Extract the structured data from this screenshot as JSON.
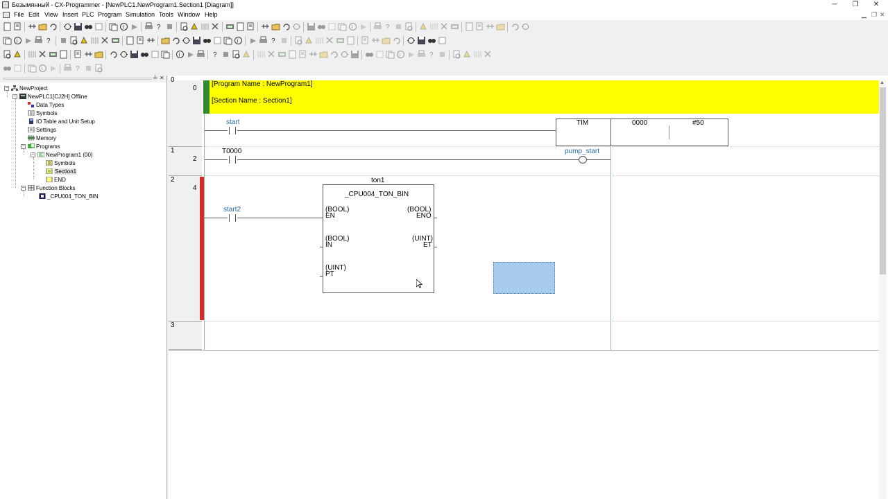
{
  "window": {
    "title": "Безымянный - CX-Programmer - [NewPLC1.NewProgram1.Section1 [Diagram]]",
    "minimize": "─",
    "restore": "❐",
    "close": "✕"
  },
  "menu": [
    "File",
    "Edit",
    "View",
    "Insert",
    "PLC",
    "Program",
    "Simulation",
    "Tools",
    "Window",
    "Help"
  ],
  "tree": {
    "project": "NewProject",
    "plc": "NewPLC1[CJ2H] Offline",
    "data_types": "Data Types",
    "symbols": "Symbols",
    "io_table": "IO Table and Unit Setup",
    "settings": "Settings",
    "memory": "Memory",
    "programs": "Programs",
    "program": "NewProgram1 (00)",
    "prog_symbols": "Symbols",
    "section": "Section1",
    "end": "END",
    "function_blocks": "Function Blocks",
    "fb": "_CPU004_TON_BIN"
  },
  "diagram": {
    "rung0": {
      "rung": "0",
      "step": "0",
      "comment1": "[Program Name : NewProgram1]",
      "comment2": "[Section Name : Section1]",
      "contact": "start",
      "instr": "TIM",
      "op1": "0000",
      "op2": "#50"
    },
    "rung1": {
      "rung": "1",
      "step": "2",
      "contact": "T0000",
      "coil": "pump_start"
    },
    "rung2": {
      "rung": "2",
      "step": "4",
      "contact": "start2",
      "instance": "ton1",
      "fb_name": "_CPU004_TON_BIN",
      "in1_type": "(BOOL)",
      "in1": "EN",
      "in2_type": "(BOOL)",
      "in2": "IN",
      "in3_type": "(UINT)",
      "in3": "PT",
      "out1_type": "(BOOL)",
      "out1": "ENO",
      "out2_type": "(UINT)",
      "out2": "ET"
    },
    "rung3": {
      "rung": "3"
    }
  },
  "colors": {
    "comment_bg": "#ffff00",
    "active_rung": "#d42a2a",
    "left_rail": "#2e8b2e",
    "selection": "#a8ccec",
    "tag_text": "#2369a3"
  }
}
